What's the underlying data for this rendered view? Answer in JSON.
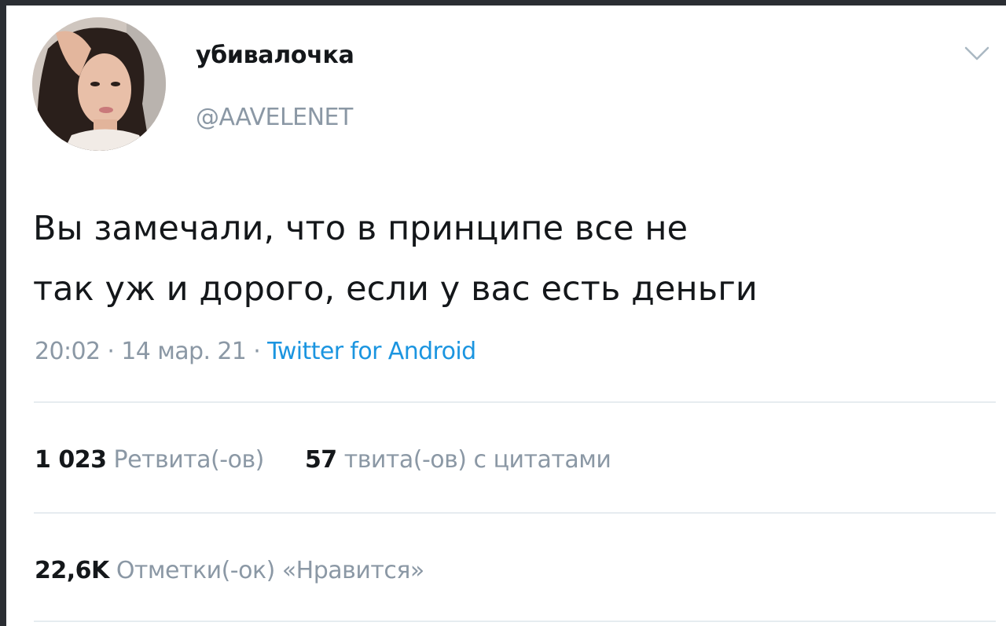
{
  "tweet": {
    "author": {
      "display_name": "убивалочка",
      "handle": "@AAVELENET"
    },
    "text_line1": "Вы замечали, что в принципе все не",
    "text_line2": "так уж и дорого, если у вас есть деньги",
    "time": "20:02",
    "date": "14 мар. 21",
    "source": "Twitter for Android",
    "separator": " · ",
    "retweets": {
      "count": "1 023",
      "label": "Ретвита(-ов)"
    },
    "quote_tweets": {
      "count": "57",
      "label": "твита(-ов) с цитатами"
    },
    "likes": {
      "count": "22,6K",
      "label": "Отметки(-ок) «Нравится»"
    }
  },
  "icons": {
    "menu": "chevron-down-icon",
    "avatar": "avatar-photo"
  },
  "colors": {
    "background": "#ffffff",
    "text": "#14171a",
    "secondary_text": "#8b98a5",
    "link": "#1b95e0",
    "divider": "#e6ecf0"
  }
}
